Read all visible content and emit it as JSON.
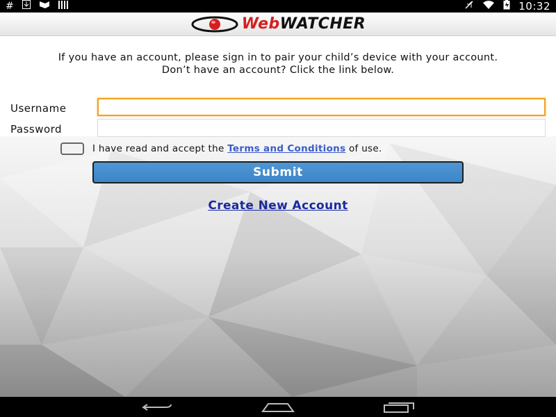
{
  "status_bar": {
    "left_icons": [
      "hash-icon",
      "download-icon",
      "flag-icon",
      "bars-icon"
    ],
    "right_icons": [
      "mute-icon",
      "wifi-icon",
      "battery-icon"
    ],
    "time": "10:32"
  },
  "header": {
    "logo_web": "Web",
    "logo_watcher": "WATCHER"
  },
  "intro": {
    "line1": "If you have an account, please sign in to pair your child’s device with your account.",
    "line2": "Don’t have an account? Click the link below."
  },
  "form": {
    "username_label": "Username",
    "username_value": "",
    "password_label": "Password",
    "password_value": "",
    "terms_prefix": "I have read and accept the ",
    "terms_link": "Terms and Conditions",
    "terms_suffix": " of use.",
    "terms_checked": false,
    "submit_label": "Submit"
  },
  "create_account_label": "Create New Account",
  "nav_bar": {
    "buttons": [
      "back-icon",
      "home-icon",
      "recents-icon"
    ]
  },
  "colors": {
    "accent_focus": "#f0a020",
    "submit_bg": "#4690d0",
    "link_blue": "#1a2aa0",
    "logo_red": "#d61f1f"
  }
}
